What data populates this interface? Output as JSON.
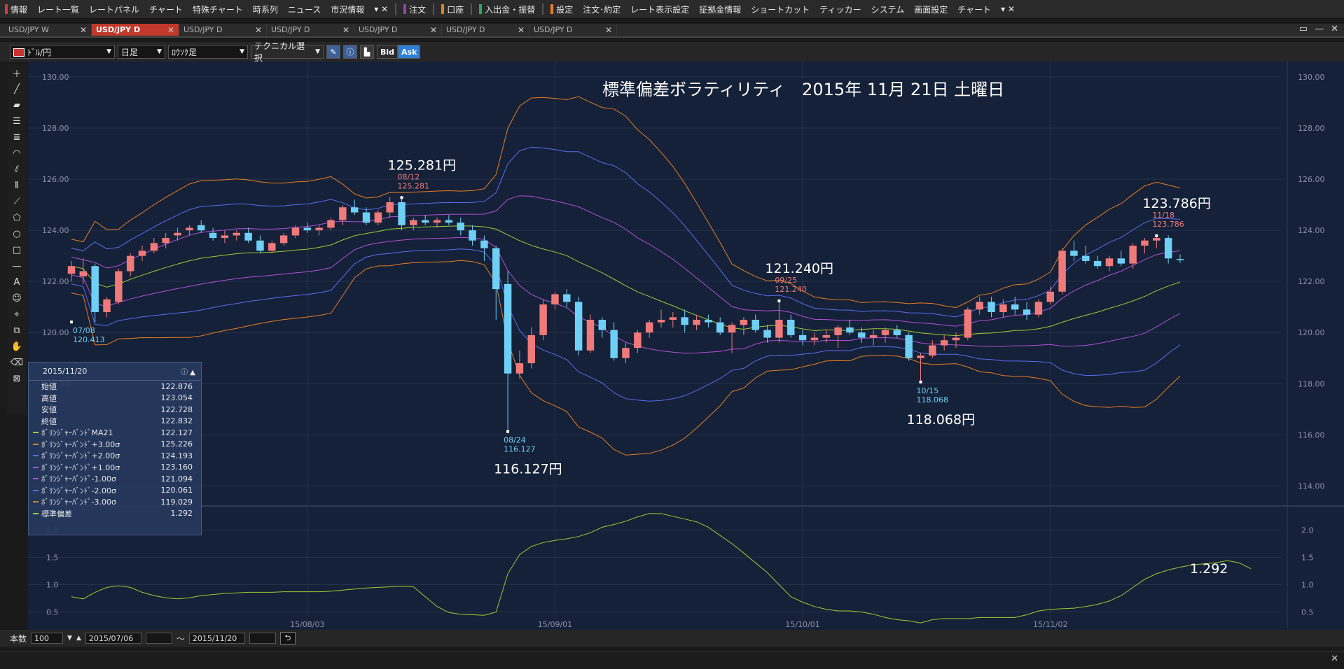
{
  "menu": {
    "items": [
      {
        "label": "情報",
        "mark": "#d83b3b"
      },
      {
        "label": "レート一覧"
      },
      {
        "label": "レートパネル"
      },
      {
        "label": "チャート"
      },
      {
        "label": "特殊チャート"
      },
      {
        "label": "時系列"
      },
      {
        "label": "ニュース"
      },
      {
        "label": "市況情報"
      },
      {
        "label": "注文",
        "mark": "#8e44ad"
      },
      {
        "label": "口座",
        "mark": "#e67e22"
      },
      {
        "label": "入出金・振替",
        "mark": "#27ae60"
      },
      {
        "label": "設定",
        "mark": "#e67e22"
      },
      {
        "label": "注文･約定"
      },
      {
        "label": "レート表示設定"
      },
      {
        "label": "証拠金情報"
      },
      {
        "label": "ショートカット"
      },
      {
        "label": "ティッカー"
      },
      {
        "label": "システム"
      },
      {
        "label": "画面設定"
      },
      {
        "label": "チャート"
      }
    ]
  },
  "tabs": [
    {
      "label": "USD/JPY W",
      "active": false
    },
    {
      "label": "USD/JPY D",
      "active": true
    },
    {
      "label": "USD/JPY D",
      "active": false
    },
    {
      "label": "USD/JPY D",
      "active": false
    },
    {
      "label": "USD/JPY D",
      "active": false
    },
    {
      "label": "USD/JPY D",
      "active": false
    },
    {
      "label": "USD/JPY D",
      "active": false
    }
  ],
  "toolbar": {
    "pair": "ﾄﾞﾙ/円",
    "period": "日足",
    "chart_kind": "ﾛｳｿｸ足",
    "technical": "テクニカル選択",
    "bid": "Bid",
    "ask": "Ask"
  },
  "info_panel": {
    "date": "2015/11/20",
    "rows": [
      {
        "label": "始値",
        "value": "122.876",
        "color": ""
      },
      {
        "label": "高値",
        "value": "123.054",
        "color": ""
      },
      {
        "label": "安値",
        "value": "122.728",
        "color": ""
      },
      {
        "label": "終値",
        "value": "122.832",
        "color": ""
      },
      {
        "label": "ﾎﾞﾘﾝｼﾞｬｰﾊﾞﾝﾄﾞMA21",
        "value": "122.127",
        "color": "#9acd32"
      },
      {
        "label": "ﾎﾞﾘﾝｼﾞｬｰﾊﾞﾝﾄﾞ+3.00σ",
        "value": "125.226",
        "color": "#e67e22"
      },
      {
        "label": "ﾎﾞﾘﾝｼﾞｬｰﾊﾞﾝﾄﾞ+2.00σ",
        "value": "124.193",
        "color": "#5a6cf0"
      },
      {
        "label": "ﾎﾞﾘﾝｼﾞｬｰﾊﾞﾝﾄﾞ+1.00σ",
        "value": "123.160",
        "color": "#b04fd8"
      },
      {
        "label": "ﾎﾞﾘﾝｼﾞｬｰﾊﾞﾝﾄﾞ-1.00σ",
        "value": "121.094",
        "color": "#b04fd8"
      },
      {
        "label": "ﾎﾞﾘﾝｼﾞｬｰﾊﾞﾝﾄﾞ-2.00σ",
        "value": "120.061",
        "color": "#5a6cf0"
      },
      {
        "label": "ﾎﾞﾘﾝｼﾞｬｰﾊﾞﾝﾄﾞ-3.00σ",
        "value": "119.029",
        "color": "#e67e22"
      },
      {
        "label": "標準偏差",
        "value": "1.292",
        "color": "#9acd32"
      }
    ]
  },
  "bottombar": {
    "count_label": "本数",
    "count_value": "100",
    "start_date": "2015/07/06",
    "tilde": "～",
    "end_date": "2015/11/20"
  },
  "chart_data": {
    "type": "candlestick",
    "title": "標準偏差ボラティリティ　2015年 11月 21日 土曜日",
    "price_ylim": [
      113.3,
      130.6
    ],
    "price_ticks": [
      "130.00",
      "128.00",
      "126.00",
      "124.00",
      "122.00",
      "120.00",
      "118.00",
      "116.00",
      "114.00"
    ],
    "x_ticks": [
      {
        "label": "15/08/03",
        "i": 20
      },
      {
        "label": "15/09/01",
        "i": 41
      },
      {
        "label": "15/10/01",
        "i": 62
      },
      {
        "label": "15/11/02",
        "i": 83
      }
    ],
    "candles": [
      [
        122.3,
        122.8,
        122.0,
        122.6
      ],
      [
        122.2,
        122.9,
        121.9,
        122.4
      ],
      [
        122.6,
        122.7,
        120.4,
        120.8
      ],
      [
        120.8,
        121.4,
        120.6,
        121.3
      ],
      [
        121.2,
        122.5,
        121.1,
        122.4
      ],
      [
        122.4,
        123.1,
        122.2,
        123.0
      ],
      [
        123.0,
        123.4,
        122.8,
        123.2
      ],
      [
        123.2,
        123.7,
        123.1,
        123.5
      ],
      [
        123.5,
        123.9,
        123.3,
        123.7
      ],
      [
        123.8,
        124.1,
        123.6,
        123.9
      ],
      [
        124.0,
        124.2,
        123.8,
        124.1
      ],
      [
        124.2,
        124.4,
        123.9,
        124.0
      ],
      [
        123.9,
        124.1,
        123.6,
        123.7
      ],
      [
        123.7,
        124.0,
        123.5,
        123.8
      ],
      [
        123.8,
        124.0,
        123.6,
        123.9
      ],
      [
        123.9,
        124.1,
        123.5,
        123.6
      ],
      [
        123.6,
        123.8,
        123.1,
        123.2
      ],
      [
        123.2,
        123.6,
        123.1,
        123.5
      ],
      [
        123.5,
        123.9,
        123.4,
        123.8
      ],
      [
        123.8,
        124.2,
        123.7,
        124.1
      ],
      [
        124.1,
        124.3,
        123.9,
        124.0
      ],
      [
        124.0,
        124.2,
        123.8,
        124.1
      ],
      [
        124.1,
        124.5,
        124.0,
        124.4
      ],
      [
        124.4,
        125.0,
        124.2,
        124.9
      ],
      [
        124.9,
        125.2,
        124.6,
        124.7
      ],
      [
        124.7,
        124.9,
        124.2,
        124.3
      ],
      [
        124.3,
        124.8,
        124.2,
        124.7
      ],
      [
        124.7,
        125.3,
        124.5,
        125.1
      ],
      [
        125.1,
        125.281,
        124.0,
        124.2
      ],
      [
        124.2,
        124.5,
        124.0,
        124.4
      ],
      [
        124.4,
        124.6,
        124.2,
        124.3
      ],
      [
        124.3,
        124.5,
        124.1,
        124.4
      ],
      [
        124.4,
        124.6,
        124.2,
        124.3
      ],
      [
        124.3,
        124.5,
        123.8,
        124.0
      ],
      [
        124.0,
        124.2,
        123.4,
        123.6
      ],
      [
        123.6,
        123.8,
        122.8,
        123.3
      ],
      [
        123.3,
        123.4,
        120.5,
        121.7
      ],
      [
        121.9,
        122.4,
        116.127,
        118.4
      ],
      [
        118.4,
        119.3,
        118.2,
        118.8
      ],
      [
        118.8,
        120.2,
        118.6,
        119.9
      ],
      [
        119.9,
        121.3,
        119.7,
        121.1
      ],
      [
        121.1,
        121.6,
        120.9,
        121.5
      ],
      [
        121.5,
        121.7,
        121.0,
        121.2
      ],
      [
        121.2,
        121.4,
        119.1,
        119.3
      ],
      [
        119.3,
        120.7,
        119.2,
        120.5
      ],
      [
        120.5,
        120.6,
        119.8,
        120.1
      ],
      [
        120.1,
        120.4,
        118.9,
        119.0
      ],
      [
        119.0,
        119.6,
        118.8,
        119.4
      ],
      [
        119.4,
        120.1,
        119.2,
        120.0
      ],
      [
        120.0,
        120.5,
        119.8,
        120.4
      ],
      [
        120.4,
        120.9,
        120.2,
        120.5
      ],
      [
        120.5,
        120.8,
        120.2,
        120.6
      ],
      [
        120.6,
        120.9,
        120.0,
        120.3
      ],
      [
        120.3,
        120.7,
        120.1,
        120.5
      ],
      [
        120.5,
        120.7,
        120.2,
        120.4
      ],
      [
        120.4,
        120.6,
        119.9,
        120.0
      ],
      [
        120.0,
        120.4,
        119.2,
        120.3
      ],
      [
        120.3,
        120.6,
        119.9,
        120.5
      ],
      [
        120.5,
        120.7,
        120.0,
        120.1
      ],
      [
        120.1,
        120.3,
        119.6,
        119.8
      ],
      [
        119.8,
        121.24,
        119.6,
        120.5
      ],
      [
        120.5,
        120.7,
        119.8,
        119.9
      ],
      [
        119.9,
        120.1,
        119.5,
        119.7
      ],
      [
        119.7,
        120.0,
        119.5,
        119.8
      ],
      [
        119.8,
        120.1,
        119.6,
        119.9
      ],
      [
        119.9,
        120.3,
        119.4,
        120.2
      ],
      [
        120.2,
        120.5,
        119.9,
        120.0
      ],
      [
        120.0,
        120.2,
        119.6,
        119.8
      ],
      [
        119.8,
        120.1,
        119.5,
        119.9
      ],
      [
        119.9,
        120.2,
        119.6,
        120.1
      ],
      [
        120.1,
        120.3,
        119.8,
        119.9
      ],
      [
        119.9,
        120.0,
        118.9,
        119.0
      ],
      [
        119.0,
        119.2,
        118.068,
        119.1
      ],
      [
        119.1,
        119.7,
        119.0,
        119.5
      ],
      [
        119.5,
        119.9,
        119.3,
        119.7
      ],
      [
        119.7,
        120.0,
        119.4,
        119.8
      ],
      [
        119.8,
        121.0,
        119.7,
        120.9
      ],
      [
        120.9,
        121.4,
        120.7,
        121.2
      ],
      [
        121.2,
        121.4,
        120.6,
        120.8
      ],
      [
        120.8,
        121.3,
        120.6,
        121.1
      ],
      [
        121.1,
        121.4,
        120.7,
        120.9
      ],
      [
        120.9,
        121.2,
        120.5,
        120.7
      ],
      [
        120.7,
        121.3,
        120.6,
        121.2
      ],
      [
        121.2,
        121.8,
        121.1,
        121.6
      ],
      [
        121.6,
        123.3,
        121.5,
        123.2
      ],
      [
        123.2,
        123.6,
        122.8,
        123.0
      ],
      [
        123.0,
        123.4,
        122.7,
        122.8
      ],
      [
        122.8,
        123.0,
        122.5,
        122.6
      ],
      [
        122.6,
        123.0,
        122.4,
        122.9
      ],
      [
        122.9,
        123.2,
        122.6,
        122.7
      ],
      [
        122.7,
        123.5,
        122.5,
        123.4
      ],
      [
        123.4,
        123.7,
        123.1,
        123.6
      ],
      [
        123.6,
        123.786,
        123.3,
        123.7
      ],
      [
        123.7,
        123.8,
        122.7,
        122.9
      ],
      [
        122.876,
        123.054,
        122.728,
        122.832
      ]
    ],
    "annotations": [
      {
        "i": 0,
        "big": "",
        "date": "07/08",
        "price": "120.413",
        "low": true,
        "v": 120.413,
        "color": "#6fd0f7"
      },
      {
        "i": 28,
        "big": "125.281円",
        "date": "08/12",
        "price": "125.281",
        "low": false,
        "v": 125.281,
        "color": "#f07a7a"
      },
      {
        "i": 37,
        "big": "116.127円",
        "date": "08/24",
        "price": "116.127",
        "low": true,
        "v": 116.127,
        "color": "#6fd0f7"
      },
      {
        "i": 60,
        "big": "121.240円",
        "date": "09/25",
        "price": "121.240",
        "low": false,
        "v": 121.24,
        "color": "#f07a7a"
      },
      {
        "i": 72,
        "big": "118.068円",
        "date": "10/15",
        "price": "118.068",
        "low": true,
        "v": 118.068,
        "color": "#6fd0f7"
      },
      {
        "i": 92,
        "big": "123.786円",
        "date": "11/18",
        "price": "123.786",
        "low": false,
        "v": 123.786,
        "color": "#f07a7a"
      }
    ],
    "indicator": {
      "name": "標準偏差",
      "ylim": [
        0.2,
        2.35
      ],
      "ticks": [
        "2.0",
        "1.5",
        "1.0",
        "0.5"
      ],
      "last_value": "1.292",
      "values": [
        0.78,
        0.74,
        0.86,
        0.95,
        0.98,
        0.95,
        0.86,
        0.8,
        0.76,
        0.74,
        0.76,
        0.8,
        0.82,
        0.84,
        0.85,
        0.86,
        0.86,
        0.86,
        0.87,
        0.87,
        0.87,
        0.87,
        0.88,
        0.9,
        0.92,
        0.94,
        0.95,
        0.96,
        0.97,
        0.96,
        0.78,
        0.6,
        0.49,
        0.46,
        0.45,
        0.44,
        0.5,
        1.2,
        1.55,
        1.7,
        1.77,
        1.81,
        1.84,
        1.88,
        1.95,
        2.05,
        2.1,
        2.16,
        2.24,
        2.3,
        2.3,
        2.25,
        2.2,
        2.15,
        2.05,
        1.9,
        1.75,
        1.58,
        1.4,
        1.22,
        1.0,
        0.78,
        0.68,
        0.6,
        0.55,
        0.52,
        0.52,
        0.5,
        0.46,
        0.4,
        0.36,
        0.34,
        0.3,
        0.36,
        0.38,
        0.38,
        0.38,
        0.4,
        0.4,
        0.4,
        0.4,
        0.45,
        0.52,
        0.55,
        0.56,
        0.57,
        0.6,
        0.64,
        0.7,
        0.8,
        0.95,
        1.1,
        1.2,
        1.27,
        1.32,
        1.36,
        1.38,
        1.4,
        1.44,
        1.4,
        1.292
      ]
    },
    "colors": {
      "up": "#f07a7a",
      "down": "#6fd0f7",
      "ma": "#9acd32",
      "s1": "#b04fd8",
      "s2": "#5a6cf0",
      "s3": "#e67e22",
      "bg": "#152138"
    }
  }
}
